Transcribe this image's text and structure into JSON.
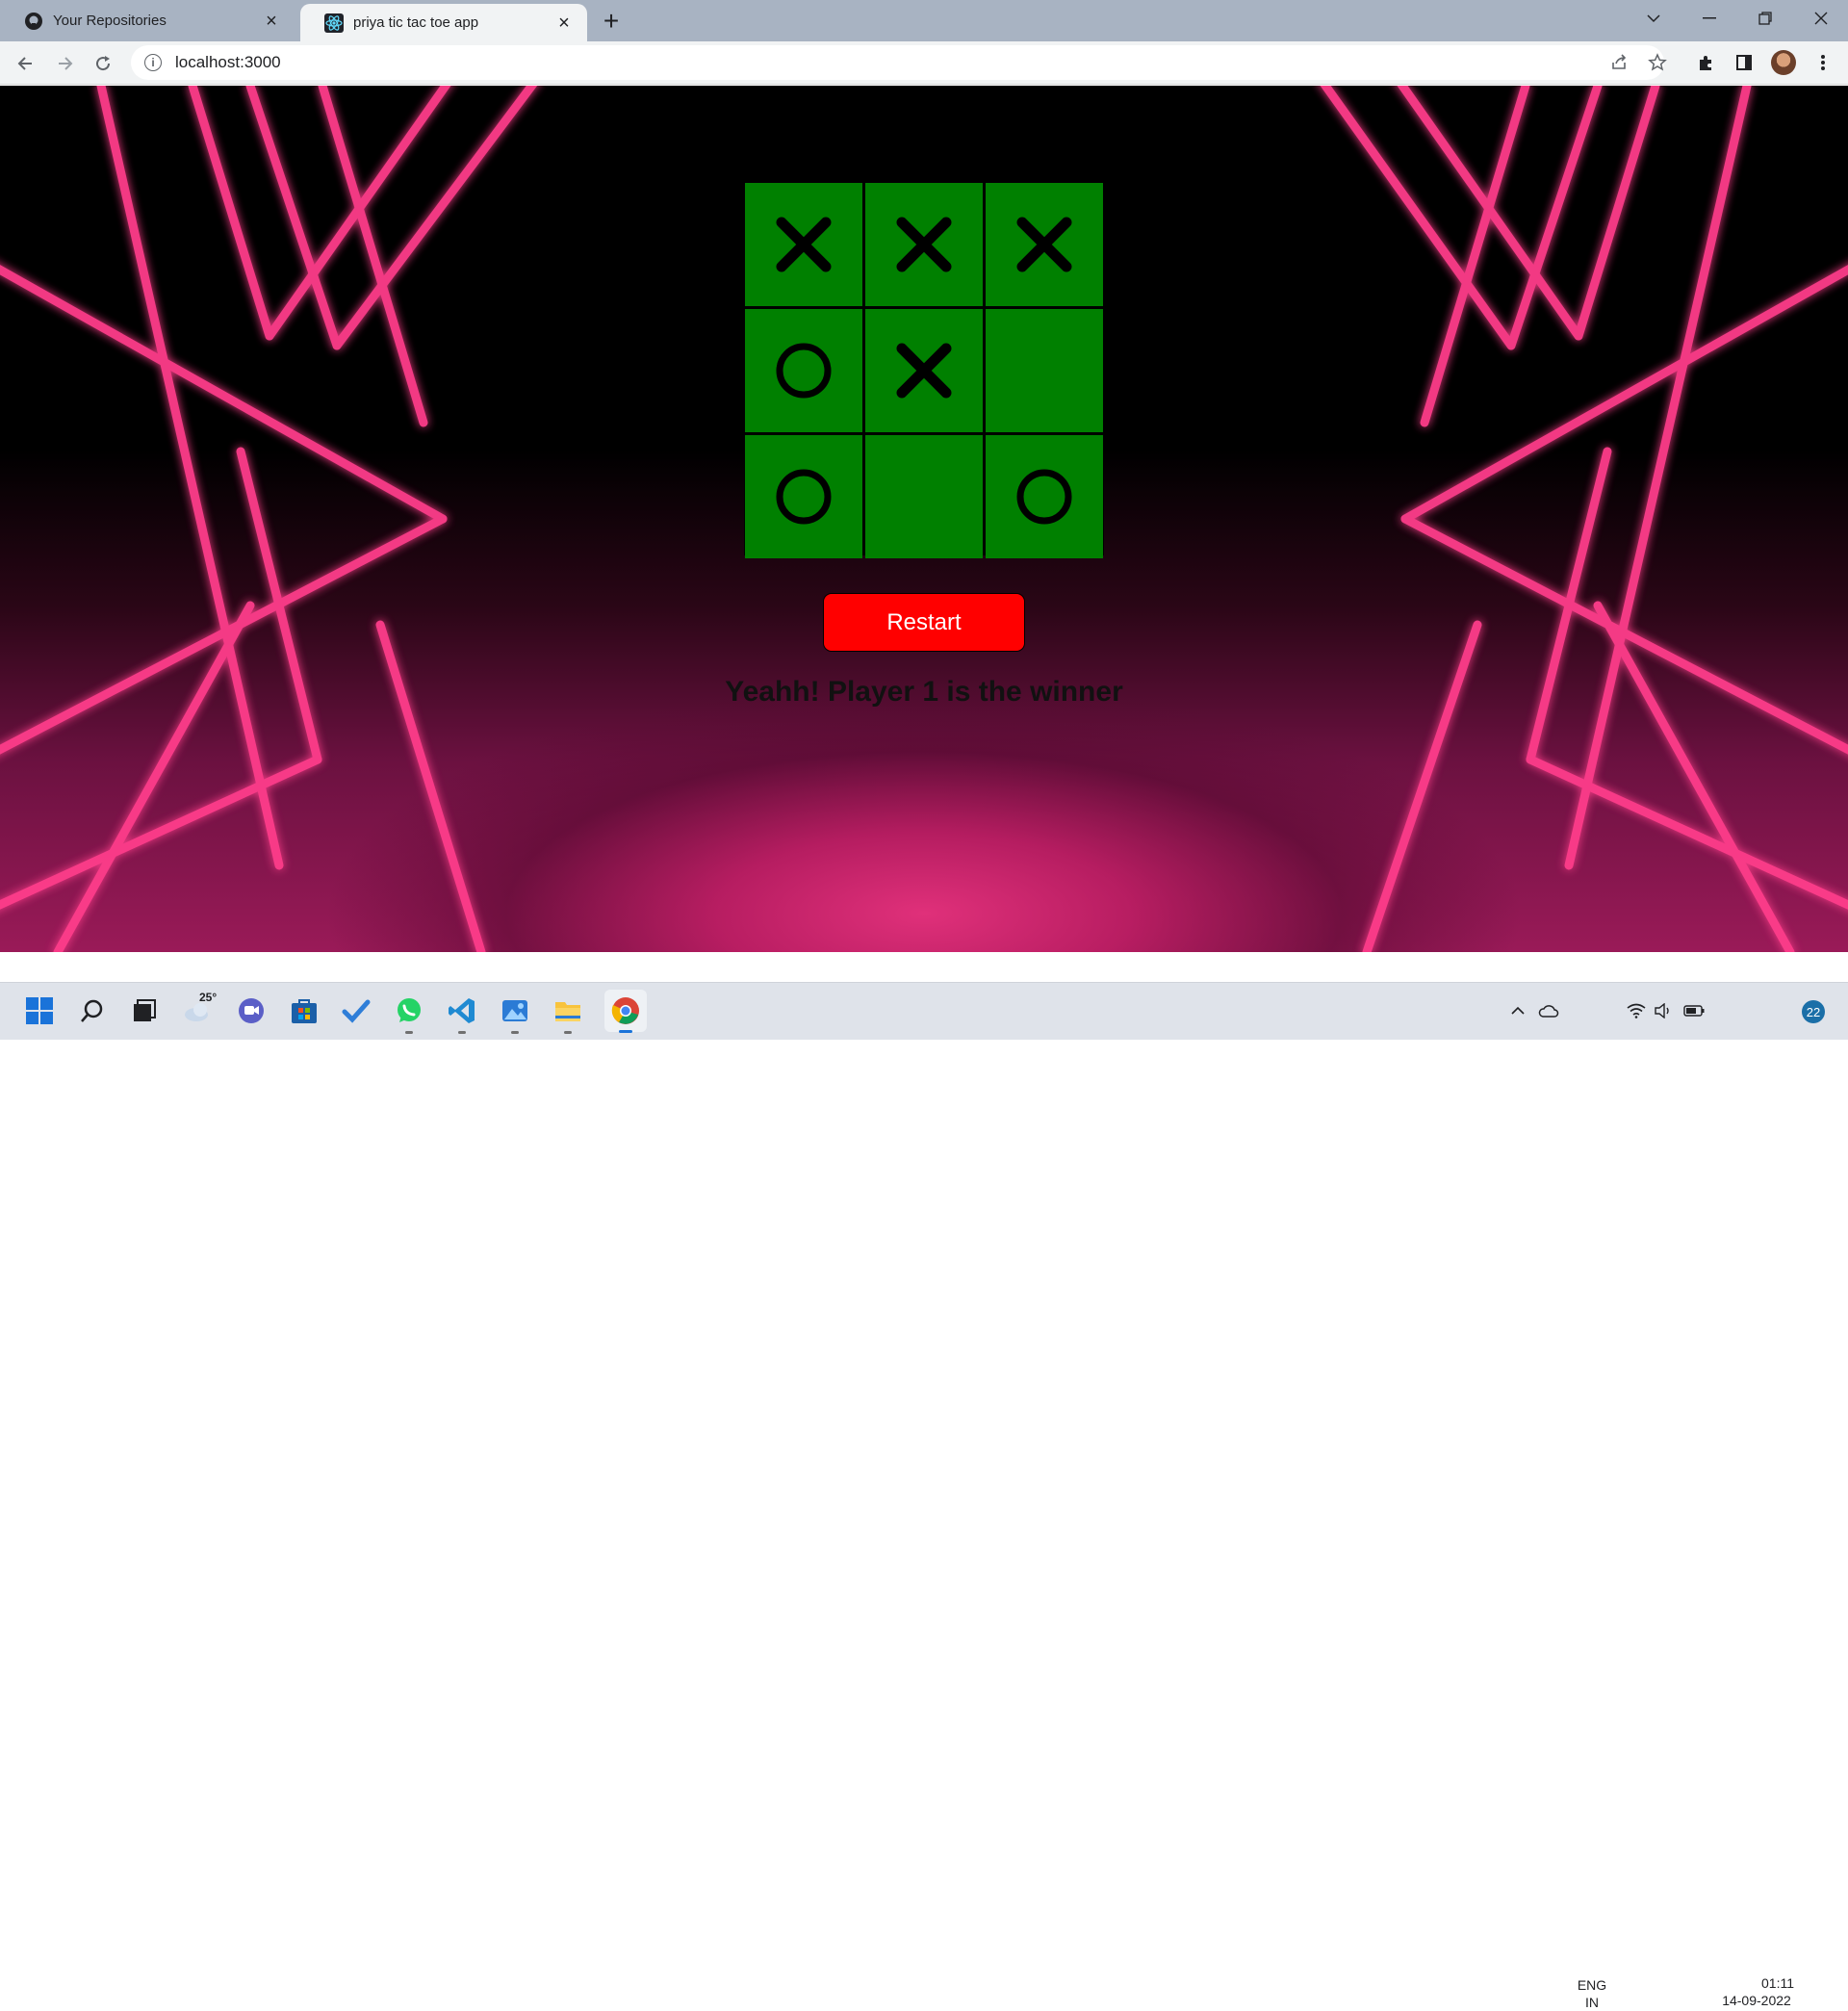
{
  "browser": {
    "tabs": [
      {
        "title": "Your Repositories",
        "icon": "github-icon",
        "active": false
      },
      {
        "title": "priya tic tac toe app",
        "icon": "react-icon",
        "active": true
      }
    ],
    "address": "localhost:3000"
  },
  "game": {
    "board": [
      "X",
      "X",
      "X",
      "O",
      "X",
      "",
      "O",
      "",
      "O"
    ],
    "restart_label": "Restart",
    "status": "Yeahh! Player 1 is the winner",
    "colors": {
      "cell": "#008000",
      "restart": "#ff0000",
      "neon": "#ff3d8b"
    }
  },
  "taskbar": {
    "weather_temp": "25°",
    "language_line1": "ENG",
    "language_line2": "IN",
    "time": "01:11",
    "date": "14-09-2022",
    "notification_count": "22"
  }
}
